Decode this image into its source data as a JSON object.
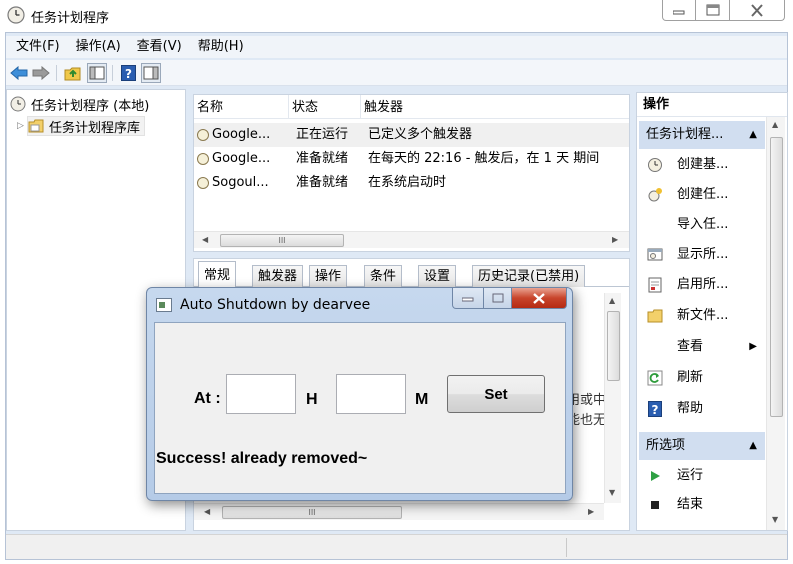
{
  "window": {
    "title": "任务计划程序",
    "controls": {
      "minimize": "—",
      "maximize": "□",
      "close": "✕"
    }
  },
  "menu": [
    "文件(F)",
    "操作(A)",
    "查看(V)",
    "帮助(H)"
  ],
  "toolbar": {
    "icons": [
      "back-arrow-icon",
      "forward-arrow-icon",
      "folder-up-icon",
      "show-hide-tree-icon",
      "help-icon",
      "show-hide-action-pane-icon"
    ]
  },
  "tree": {
    "root": "任务计划程序 (本地)",
    "child": "任务计划程序库",
    "expander": "▷"
  },
  "task_list": {
    "columns": [
      "名称",
      "状态",
      "触发器"
    ],
    "rows": [
      {
        "name": "Google...",
        "status": "正在运行",
        "trigger": "已定义多个触发器"
      },
      {
        "name": "Google...",
        "status": "准备就绪",
        "trigger": "在每天的 22:16 - 触发后，在 1 天 期间"
      },
      {
        "name": "Sogoul...",
        "status": "准备就绪",
        "trigger": "在系统启动时"
      }
    ],
    "scroll_thumb_grip": "III"
  },
  "detail": {
    "tabs": [
      "常规",
      "触发器",
      "操作",
      "条件",
      "设置",
      "历史记录(已禁用)"
    ],
    "partial_text_1": "用或中",
    "partial_text_2": "能也无",
    "scroll_thumb_grip": "III"
  },
  "actions": {
    "title": "操作",
    "section1": "任务计划程...",
    "items1": [
      {
        "label": "创建基...",
        "icon": "create-basic-task-icon"
      },
      {
        "label": "创建任...",
        "icon": "create-task-icon"
      },
      {
        "label": "导入任...",
        "icon": ""
      },
      {
        "label": "显示所...",
        "icon": "display-running-tasks-icon"
      },
      {
        "label": "启用所...",
        "icon": "enable-history-icon"
      },
      {
        "label": "新文件...",
        "icon": "new-folder-icon"
      },
      {
        "label": "查看",
        "icon": ""
      },
      {
        "label": "刷新",
        "icon": "refresh-icon"
      },
      {
        "label": "帮助",
        "icon": "help-icon"
      }
    ],
    "section2": "所选项",
    "items2": [
      {
        "label": "运行",
        "icon": "run-icon"
      },
      {
        "label": "结束",
        "icon": "end-icon"
      }
    ]
  },
  "dialog": {
    "title": "Auto Shutdown by dearvee",
    "at_label": "At :",
    "hour_value": "",
    "hour_label": "H",
    "minute_value": "",
    "minute_label": "M",
    "set_button": "Set",
    "status": "Success! already removed~",
    "controls": {
      "minimize": "—",
      "maximize": "□",
      "close": "✕"
    }
  }
}
